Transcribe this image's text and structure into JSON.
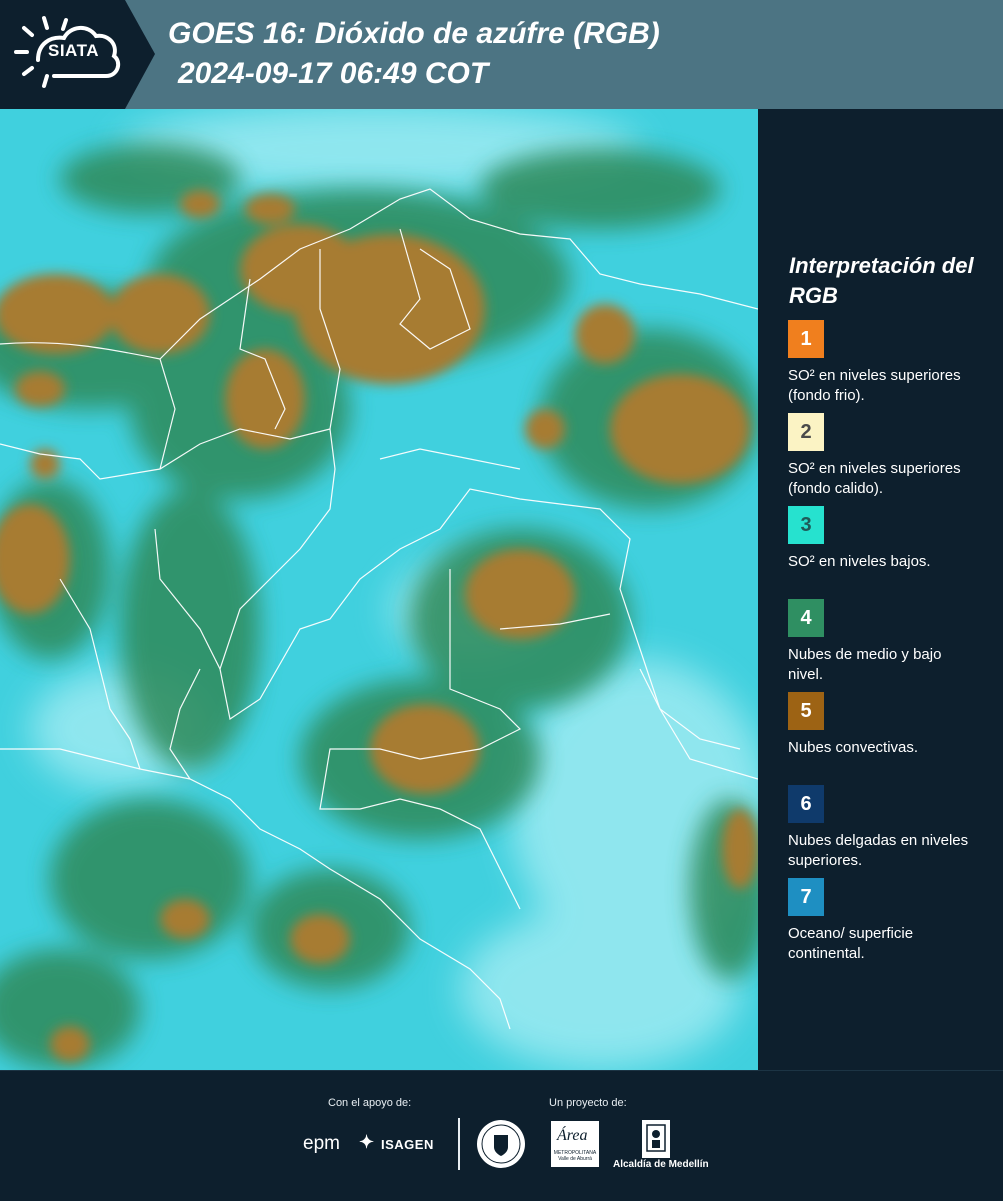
{
  "header": {
    "logo_text": "SIATA",
    "title_line1": "GOES 16: Dióxido de azúfre (RGB)",
    "title_line2": "2024-09-17 06:49 COT"
  },
  "map": {
    "colors": {
      "ocean_land": "#3fd2e0",
      "light_surface": "#9eecf4",
      "low_mid_cloud": "#2f8a5a",
      "convective": "#a67a30",
      "borders": "#ffffff"
    }
  },
  "legend": {
    "title": "Interpretación del RGB",
    "items": [
      {
        "number": "1",
        "color": "#f07f1e",
        "text_color": "#ffffff",
        "label": "SO² en niveles superiores (fondo frio)."
      },
      {
        "number": "2",
        "color": "#fbf3c4",
        "text_color": "#4a4a4a",
        "label": "SO² en niveles superiores (fondo calido)."
      },
      {
        "number": "3",
        "color": "#26e2cf",
        "text_color": "#1f5a58",
        "label": "SO² en niveles bajos."
      },
      {
        "number": "4",
        "color": "#2f8f62",
        "text_color": "#ffffff",
        "label": "Nubes de medio y bajo nivel."
      },
      {
        "number": "5",
        "color": "#9d6314",
        "text_color": "#ffffff",
        "label": "Nubes convectivas."
      },
      {
        "number": "6",
        "color": "#0f3a6b",
        "text_color": "#ffffff",
        "label": "Nubes delgadas en niveles superiores."
      },
      {
        "number": "7",
        "color": "#1e8fc2",
        "text_color": "#ffffff",
        "label": "Oceano/ superficie continental."
      }
    ]
  },
  "footer": {
    "support_label": "Con el apoyo de:",
    "project_label": "Un proyecto de:",
    "epm": "epm",
    "isagen": "ISAGEN",
    "area_logo": "Área",
    "area_sub": "METROPOLITANA Valle de Aburrá",
    "alcaldia": "Alcaldía de Medellín"
  }
}
